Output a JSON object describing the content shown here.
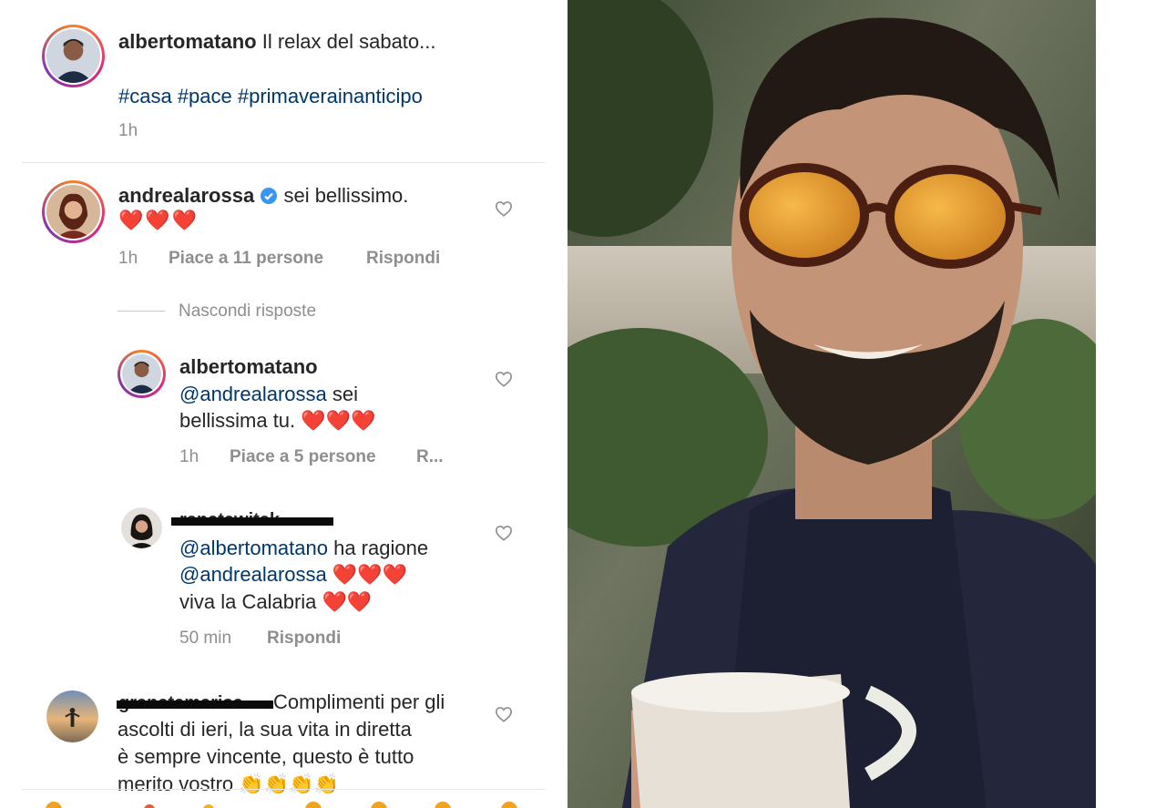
{
  "post": {
    "author": "albertomatano",
    "caption": "Il relax del sabato...",
    "hashtags": "#casa #pace #primaverainanticipo",
    "time": "1h"
  },
  "comments": [
    {
      "user": "andrealarossa",
      "verified": true,
      "text": "sei bellissimo.",
      "hearts": "❤️❤️❤️",
      "time": "1h",
      "likes": "Piace a 11 persone",
      "reply": "Rispondi"
    }
  ],
  "hide_replies": "Nascondi risposte",
  "replies": [
    {
      "user": "albertomatano",
      "mention": "@andrealarossa",
      "text_line1": " sei",
      "text_line2": "bellissima tu. ",
      "hearts": "❤️❤️❤️",
      "time": "1h",
      "likes": "Piace a 5 persone",
      "reply": "R..."
    },
    {
      "user_redacted": "renatawitek",
      "mention1": "@albertomatano",
      "text1": " ha ragione",
      "mention2": "@andrealarossa",
      "hearts1": "❤️❤️❤️",
      "text2": "viva la Calabria ",
      "hearts2": "❤️❤️",
      "time": "50 min",
      "reply": "Rispondi"
    }
  ],
  "comment2": {
    "user_redacted": "granatamarisa",
    "line1": "Complimenti per gli",
    "line2": "ascolti di ieri, la sua vita in diretta",
    "line3": "è sempre vincente, questo è tutto",
    "line4": "merito vostro ",
    "claps": "👏👏👏👏"
  },
  "icons": {
    "like": "heart-outline-icon",
    "verified": "verified-badge-icon"
  },
  "colors": {
    "mention": "#00376b",
    "meta": "#8e8e8e",
    "heart": "#e0131c"
  }
}
